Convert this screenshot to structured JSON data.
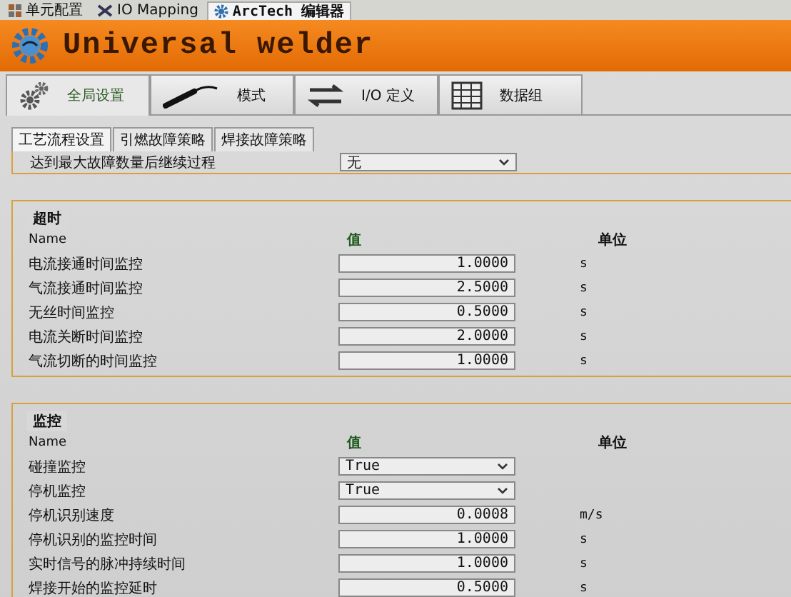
{
  "doc_tabs": [
    {
      "label": "单元配置",
      "selected": false
    },
    {
      "label": "IO Mapping",
      "selected": false
    },
    {
      "label": "ArcTech 编辑器",
      "selected": true
    }
  ],
  "banner": {
    "title": "Universal welder"
  },
  "main_tabs": [
    {
      "label": "全局设置",
      "selected": true
    },
    {
      "label": "模式",
      "selected": false
    },
    {
      "label": "I/O 定义",
      "selected": false
    },
    {
      "label": "数据组",
      "selected": false
    }
  ],
  "sub_tabs": [
    {
      "label": "工艺流程设置",
      "selected": true
    },
    {
      "label": "引燃故障策略",
      "selected": false
    },
    {
      "label": "焊接故障策略",
      "selected": false
    }
  ],
  "top_row": {
    "name": "达到最大故障数量后继续过程",
    "kind": "dropdown",
    "value": "无"
  },
  "sections": [
    {
      "title": "超时",
      "columns": [
        "Name",
        "值",
        "单位"
      ],
      "rows": [
        {
          "name": "电流接通时间监控",
          "kind": "number",
          "value": "1.0000",
          "unit": "s"
        },
        {
          "name": "气流接通时间监控",
          "kind": "number",
          "value": "2.5000",
          "unit": "s"
        },
        {
          "name": "无丝时间监控",
          "kind": "number",
          "value": "0.5000",
          "unit": "s"
        },
        {
          "name": "电流关断时间监控",
          "kind": "number",
          "value": "2.0000",
          "unit": "s"
        },
        {
          "name": "气流切断的时间监控",
          "kind": "number",
          "value": "1.0000",
          "unit": "s"
        }
      ]
    },
    {
      "title": "监控",
      "columns": [
        "Name",
        "值",
        "单位"
      ],
      "rows": [
        {
          "name": "碰撞监控",
          "kind": "dropdown",
          "value": "True"
        },
        {
          "name": "停机监控",
          "kind": "dropdown",
          "value": "True"
        },
        {
          "name": "停机识别速度",
          "kind": "number",
          "value": "0.0008",
          "unit": "m/s"
        },
        {
          "name": "停机识别的监控时间",
          "kind": "number",
          "value": "1.0000",
          "unit": "s"
        },
        {
          "name": "实时信号的脉冲持续时间",
          "kind": "number",
          "value": "1.0000",
          "unit": "s"
        },
        {
          "name": "焊接开始的监控延时",
          "kind": "number",
          "value": "0.5000",
          "unit": "s"
        }
      ]
    }
  ]
}
